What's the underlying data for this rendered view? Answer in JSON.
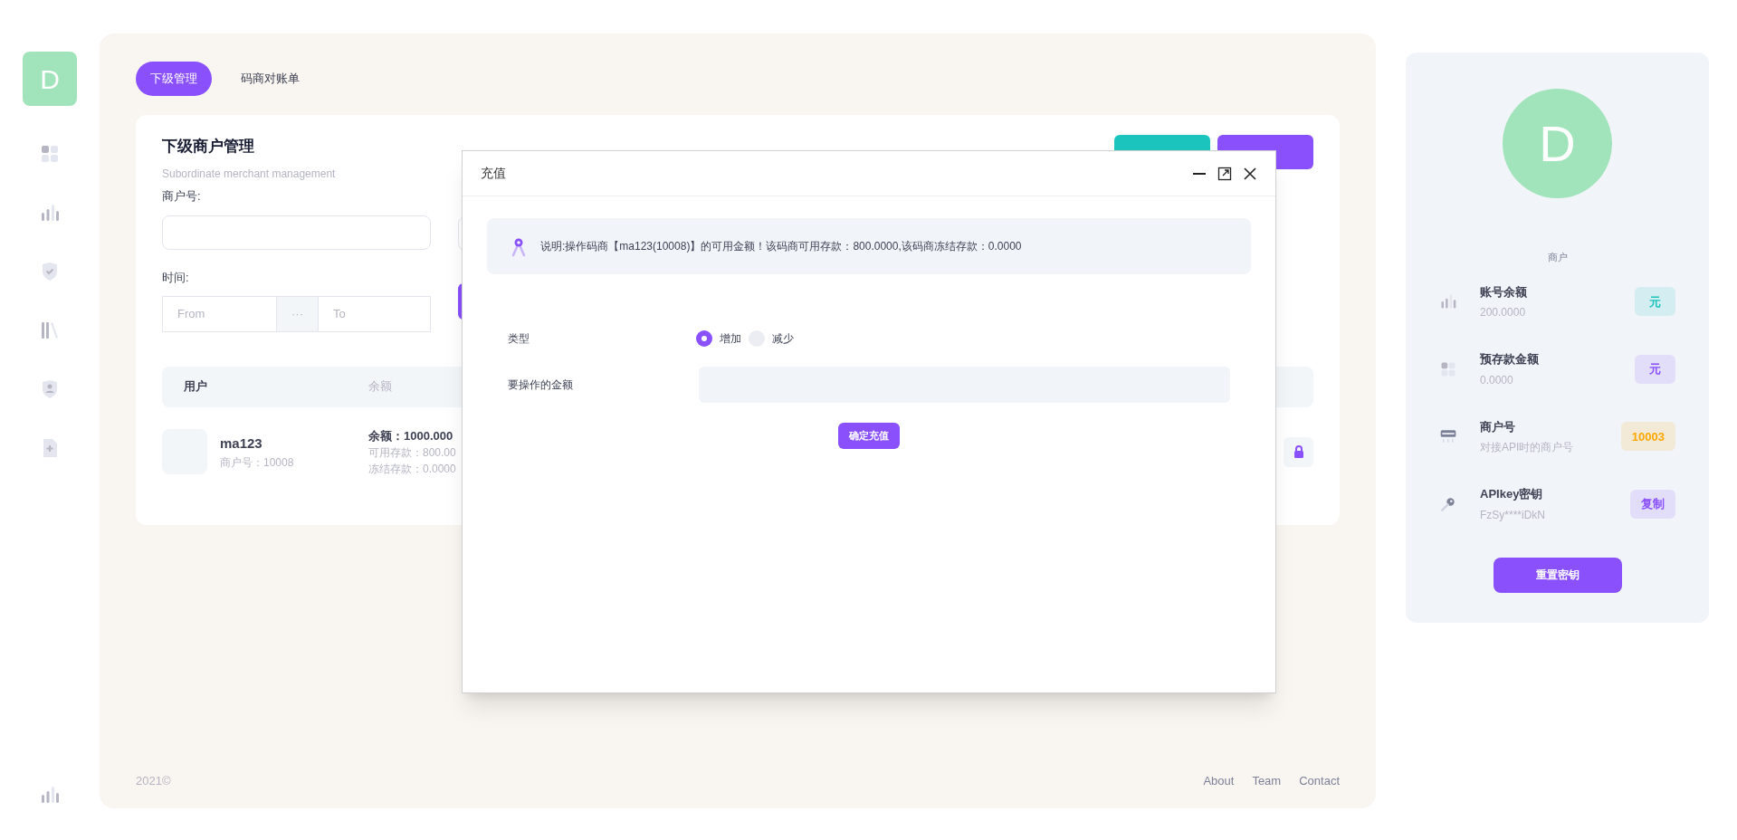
{
  "sidebar": {
    "avatar": "D",
    "items": [
      {
        "kind": "grid",
        "selected": false
      },
      {
        "kind": "chart",
        "selected": false
      },
      {
        "kind": "shield-check",
        "selected": false
      },
      {
        "kind": "library",
        "selected": false
      },
      {
        "kind": "shield-user",
        "selected": false
      },
      {
        "kind": "file-plus",
        "selected": false
      }
    ]
  },
  "tabs": [
    {
      "label": "下级管理",
      "selected": true
    },
    {
      "label": "码商对账单",
      "selected": false
    }
  ],
  "card": {
    "title": "下级商户管理",
    "subtitle": "Subordinate merchant management",
    "filters": {
      "merchant_label": "商户号:",
      "time_label": "时间:",
      "from_placeholder": "From",
      "separator": "···",
      "to_placeholder": "To"
    },
    "table": {
      "columns": [
        "用户",
        "余额"
      ],
      "rows": [
        {
          "name": "ma123",
          "merchant_no": "商户号：10008",
          "balance": "余额：1000.000",
          "available": "可用存款：800.00",
          "frozen": "冻结存款：0.0000"
        }
      ]
    }
  },
  "dialog": {
    "title": "充值",
    "note": "说明:操作码商【ma123(10008)】的可用金额！该码商可用存款：800.0000,该码商冻结存款：0.0000",
    "type_label": "类型",
    "type_options": [
      {
        "label": "增加",
        "selected": true
      },
      {
        "label": "减少",
        "selected": false
      }
    ],
    "amount_label": "要操作的金额",
    "submit": "确定充值"
  },
  "footer": {
    "copyright": "2021©",
    "links": [
      "About",
      "Team",
      "Contact"
    ]
  },
  "profile": {
    "avatar": "D",
    "role": "商户",
    "rows": [
      {
        "kind": "chart",
        "title": "账号余额",
        "subtitle": "200.0000",
        "badge": "元",
        "color": "#1bc5bd"
      },
      {
        "kind": "grid",
        "title": "预存款金额",
        "subtitle": "0.0000",
        "badge": "元",
        "color": "#8950fc"
      },
      {
        "kind": "card",
        "title": "商户号",
        "subtitle": "对接API时的商户号",
        "badge": "10003",
        "color": "#ffa800"
      },
      {
        "kind": "key",
        "title": "APIkey密钥",
        "subtitle": "FzSy****iDkN",
        "badge": "复制",
        "color": "#8950fc"
      }
    ],
    "reset_button": "重置密钥"
  }
}
